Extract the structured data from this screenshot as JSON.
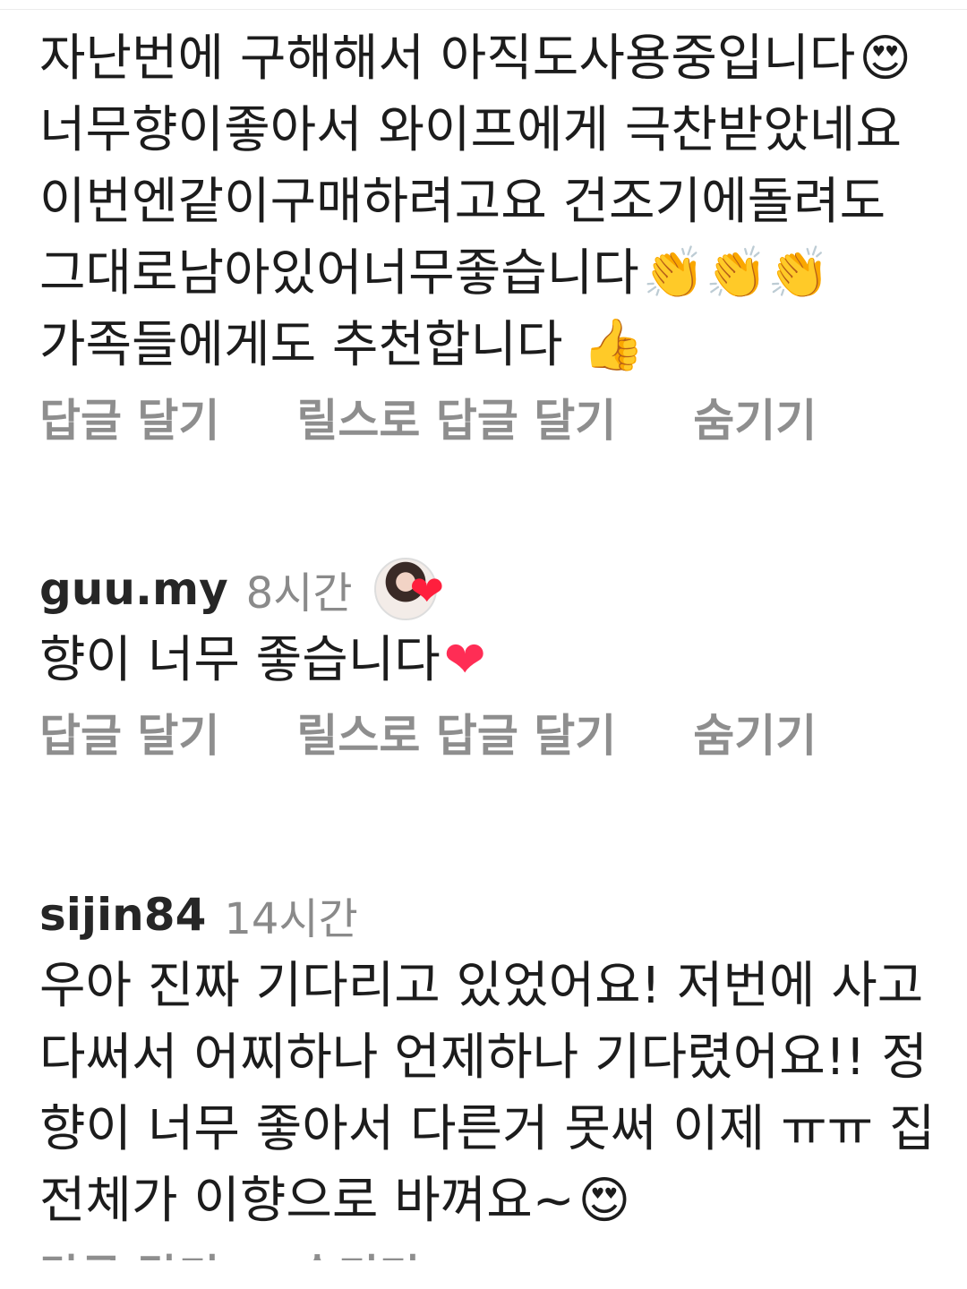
{
  "comments": [
    {
      "lines": [
        {
          "text": "자난번에 구해해서 아직도사용중입니다",
          "emoji": "😍"
        },
        {
          "text": "너무향이좋아서 와이프에게 극찬받았네요",
          "emoji": ""
        },
        {
          "text": "이번엔같이구매하려고요  건조기에돌려도",
          "emoji": ""
        },
        {
          "text": "그대로남아있어너무좋습니다",
          "emoji": "👏👏👏"
        },
        {
          "text": "가족들에게도 추천합니다 ",
          "emoji": "👍"
        }
      ],
      "actions": {
        "reply": "답글 달기",
        "reply_reels": "릴스로 답글 달기",
        "hide": "숨기기"
      }
    },
    {
      "username": "guu.my",
      "time": "8시간",
      "liked_by_author_heart": "❤",
      "lines": [
        {
          "text": "향이 너무 좋습니다",
          "emoji": "❤"
        }
      ],
      "actions": {
        "reply": "답글 달기",
        "reply_reels": "릴스로 답글 달기",
        "hide": "숨기기"
      }
    },
    {
      "username": "sijin84",
      "time": "14시간",
      "lines": [
        {
          "text": "우아 진짜 기다리고 있었어요! 저번에 사고",
          "emoji": ""
        },
        {
          "text": "다써서 어찌하나 언제하나 기다렸어요!! 정",
          "emoji": ""
        },
        {
          "text": "향이 너무 좋아서 다른거 못써 이제 ㅠㅠ 집",
          "emoji": ""
        },
        {
          "text": "전체가 이향으로 바껴요~",
          "emoji": "😍"
        }
      ],
      "actions": {
        "reply": "답글 달기",
        "reply_reels": "릴스로 답글 달기",
        "hide": "숨기기"
      }
    }
  ]
}
